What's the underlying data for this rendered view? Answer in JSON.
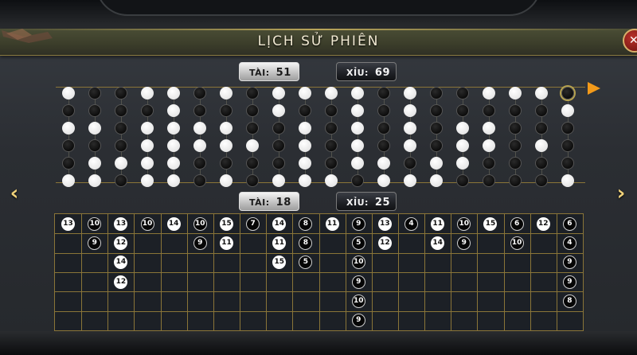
{
  "title": "LỊCH SỬ PHIÊN",
  "close_label": "✕",
  "top_summary": {
    "tai_label": "TÀI:",
    "tai_value": "51",
    "xiu_label": "XỈU:",
    "xiu_value": "69"
  },
  "bottom_summary": {
    "tai_label": "TÀI:",
    "tai_value": "18",
    "xiu_label": "XỈU:",
    "xiu_value": "25"
  },
  "nav": {
    "prev": "‹",
    "next": "›"
  },
  "dot_history": [
    [
      "w",
      "b",
      "w",
      "b",
      "b",
      "w"
    ],
    [
      "b",
      "b",
      "w",
      "b",
      "w",
      "w"
    ],
    [
      "b",
      "b",
      "b",
      "b",
      "w",
      "b"
    ],
    [
      "w",
      "b",
      "w",
      "w",
      "w",
      "w"
    ],
    [
      "w",
      "w",
      "w",
      "w",
      "w",
      "w"
    ],
    [
      "b",
      "b",
      "w",
      "w",
      "b",
      "b"
    ],
    [
      "w",
      "b",
      "w",
      "w",
      "b",
      "w"
    ],
    [
      "b",
      "b",
      "b",
      "w",
      "b",
      "b"
    ],
    [
      "w",
      "w",
      "b",
      "b",
      "b",
      "w"
    ],
    [
      "w",
      "b",
      "w",
      "w",
      "w",
      "w"
    ],
    [
      "w",
      "b",
      "b",
      "b",
      "b",
      "w"
    ],
    [
      "w",
      "w",
      "w",
      "w",
      "w",
      "b"
    ],
    [
      "b",
      "b",
      "b",
      "b",
      "w",
      "w"
    ],
    [
      "w",
      "w",
      "w",
      "w",
      "b",
      "w"
    ],
    [
      "b",
      "b",
      "b",
      "b",
      "w",
      "w"
    ],
    [
      "b",
      "b",
      "w",
      "w",
      "w",
      "b"
    ],
    [
      "w",
      "b",
      "w",
      "w",
      "b",
      "b"
    ],
    [
      "w",
      "b",
      "b",
      "b",
      "b",
      "b"
    ],
    [
      "w",
      "b",
      "b",
      "w",
      "b",
      "b"
    ],
    [
      "b",
      "w",
      "b",
      "b",
      "b",
      "w"
    ]
  ],
  "dot_colors": {
    "white": "#ffffff",
    "black": "#000000",
    "accent_arrow": "#f39a1a"
  },
  "sum_columns": [
    [
      {
        "v": "13",
        "c": "w"
      }
    ],
    [
      {
        "v": "10",
        "c": "b"
      },
      {
        "v": "9",
        "c": "b"
      }
    ],
    [
      {
        "v": "13",
        "c": "w"
      },
      {
        "v": "12",
        "c": "w"
      },
      {
        "v": "14",
        "c": "w"
      },
      {
        "v": "12",
        "c": "w"
      }
    ],
    [
      {
        "v": "10",
        "c": "b"
      }
    ],
    [
      {
        "v": "14",
        "c": "w"
      }
    ],
    [
      {
        "v": "10",
        "c": "b"
      },
      {
        "v": "9",
        "c": "b"
      }
    ],
    [
      {
        "v": "15",
        "c": "w"
      },
      {
        "v": "11",
        "c": "w"
      }
    ],
    [
      {
        "v": "7",
        "c": "b"
      }
    ],
    [
      {
        "v": "14",
        "c": "w"
      },
      {
        "v": "11",
        "c": "w"
      },
      {
        "v": "15",
        "c": "w"
      }
    ],
    [
      {
        "v": "8",
        "c": "b"
      },
      {
        "v": "8",
        "c": "b"
      },
      {
        "v": "5",
        "c": "b"
      }
    ],
    [
      {
        "v": "11",
        "c": "w"
      }
    ],
    [
      {
        "v": "9",
        "c": "b"
      },
      {
        "v": "5",
        "c": "b"
      },
      {
        "v": "10",
        "c": "b"
      },
      {
        "v": "9",
        "c": "b"
      },
      {
        "v": "10",
        "c": "b"
      },
      {
        "v": "9",
        "c": "b"
      }
    ],
    [
      {
        "v": "13",
        "c": "w"
      },
      {
        "v": "12",
        "c": "w"
      }
    ],
    [
      {
        "v": "4",
        "c": "b"
      }
    ],
    [
      {
        "v": "11",
        "c": "w"
      },
      {
        "v": "14",
        "c": "w"
      }
    ],
    [
      {
        "v": "10",
        "c": "b"
      },
      {
        "v": "9",
        "c": "b"
      }
    ],
    [
      {
        "v": "15",
        "c": "w"
      }
    ],
    [
      {
        "v": "6",
        "c": "b"
      },
      {
        "v": "10",
        "c": "b"
      }
    ],
    [
      {
        "v": "12",
        "c": "w"
      }
    ],
    [
      {
        "v": "6",
        "c": "b"
      },
      {
        "v": "4",
        "c": "b"
      },
      {
        "v": "9",
        "c": "b"
      },
      {
        "v": "9",
        "c": "b"
      },
      {
        "v": "8",
        "c": "b"
      }
    ]
  ]
}
